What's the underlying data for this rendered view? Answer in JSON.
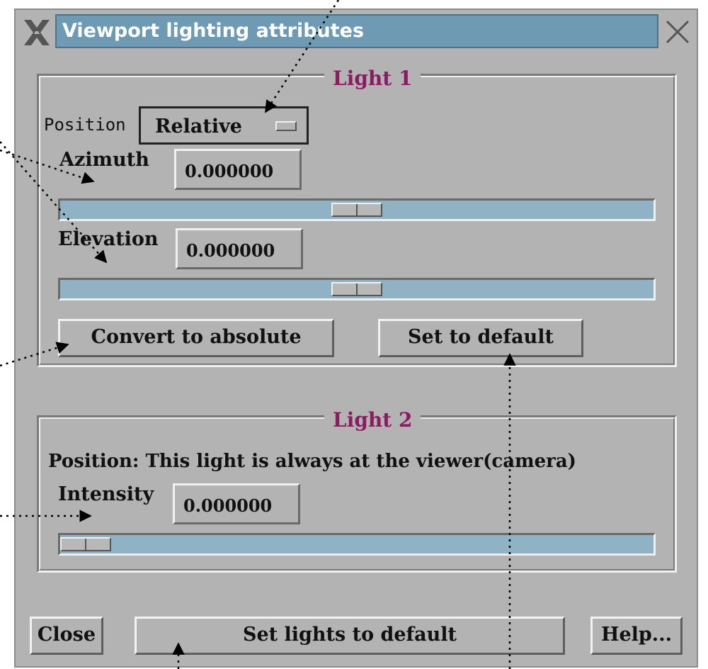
{
  "window": {
    "title": "Viewport lighting attributes"
  },
  "light1": {
    "legend": "Light 1",
    "position_label": "Position",
    "position_value": "Relative",
    "azimuth_label": "Azimuth",
    "azimuth_value": "0.000000",
    "azimuth_slider": 0.5,
    "elevation_label": "Elevation",
    "elevation_value": "0.000000",
    "elevation_slider": 0.5,
    "convert_button": "Convert to absolute",
    "default_button": "Set to default"
  },
  "light2": {
    "legend": "Light 2",
    "position_text": "Position: This light is always at the viewer(camera)",
    "intensity_label": "Intensity",
    "intensity_value": "0.000000",
    "intensity_slider": 0.0
  },
  "footer": {
    "close_button": "Close",
    "lights_default_button": "Set lights to default",
    "help_button": "Help..."
  },
  "icons": {
    "window_menu": "x-logo-icon",
    "window_close": "close-icon"
  },
  "colors": {
    "title_bar": "#6e9ab4",
    "legend_text": "#8c1b62",
    "slider_trough": "#8fb2c4",
    "panel": "#b3b3b3"
  }
}
